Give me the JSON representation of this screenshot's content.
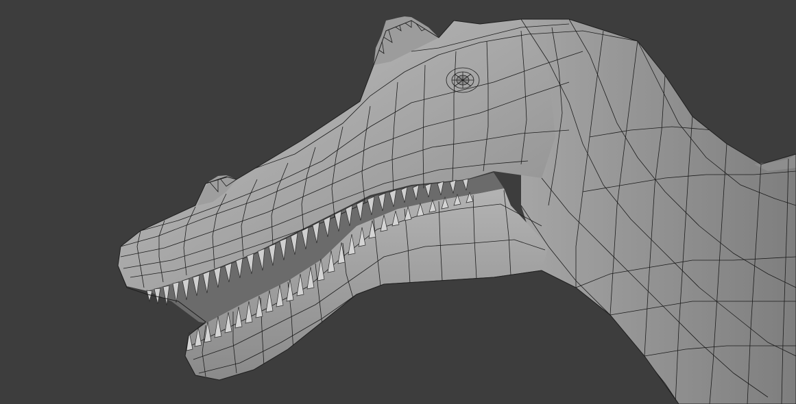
{
  "viewport": {
    "background_color": "#3d3d3d",
    "mesh_fill_color": "#a9a9a9",
    "wireframe_color": "#1a1a1a",
    "teeth_color": "#c8c8c8",
    "subject": "spinosaurus-head-wireframe-mesh"
  }
}
